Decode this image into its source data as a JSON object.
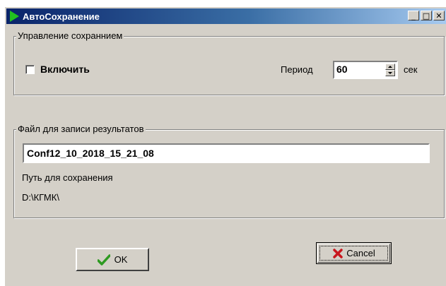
{
  "window": {
    "title": "АвтоСохранение",
    "controls": {
      "minimize": "_",
      "maximize": "□",
      "close": "✕"
    }
  },
  "save_group": {
    "legend": "Управление сохраннием",
    "enable_label": "Включить",
    "enable_checked": false,
    "period_label": "Период",
    "period_value": "60",
    "unit_label": "сек"
  },
  "file_group": {
    "legend": "Файл для записи результатов",
    "file_name": "Conf12_10_2018_15_21_08",
    "path_label": "Путь для сохранения",
    "path_value": "D:\\КГМК\\"
  },
  "buttons": {
    "ok_label": "OK",
    "cancel_label": "Cancel"
  },
  "colors": {
    "check": "#2e9a21",
    "cross": "#c8161d",
    "app_icon": "#22c21f"
  }
}
